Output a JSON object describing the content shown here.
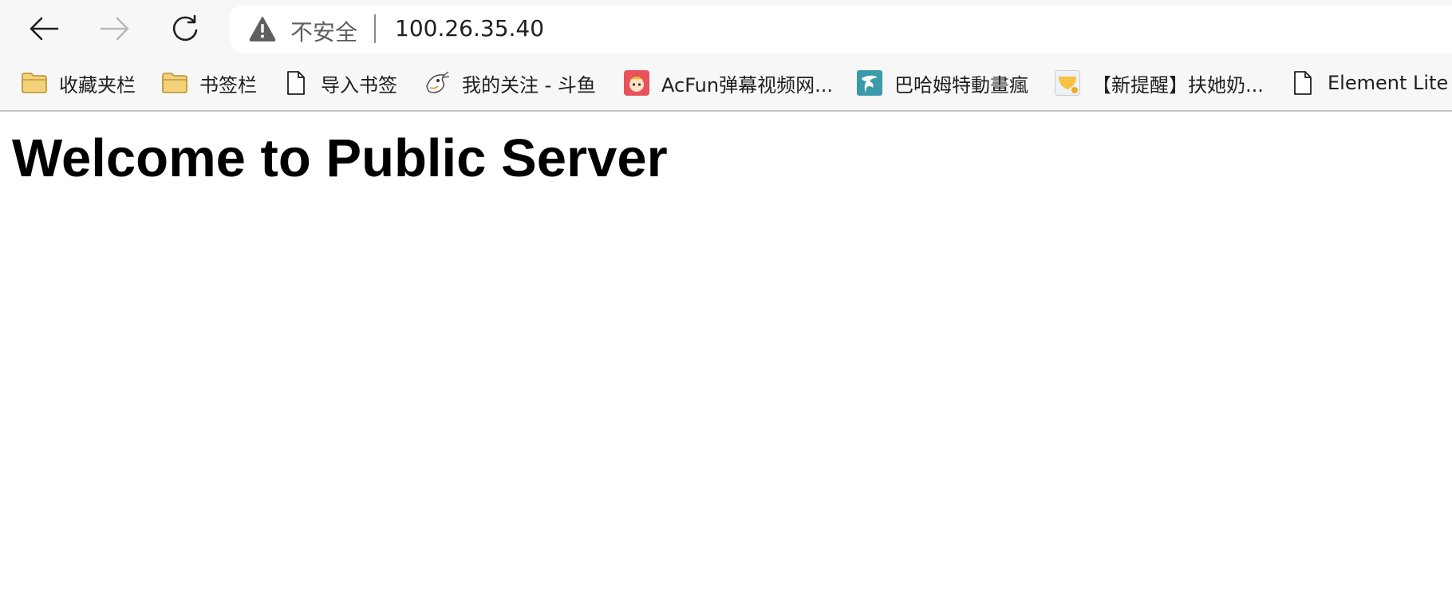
{
  "address_bar": {
    "security_label": "不安全",
    "url": "100.26.35.40"
  },
  "navigation": {
    "back_icon": "arrow-left-icon",
    "forward_icon": "arrow-right-icon",
    "forward_enabled": false,
    "reload_icon": "reload-icon"
  },
  "bookmarks": [
    {
      "label": "收藏夹栏",
      "icon": "folder-icon"
    },
    {
      "label": "书签栏",
      "icon": "folder-icon"
    },
    {
      "label": "导入书签",
      "icon": "page-icon"
    },
    {
      "label": "我的关注 - 斗鱼",
      "icon": "douyu-fish-icon"
    },
    {
      "label": "AcFun弹幕视频网...",
      "icon": "acfun-icon"
    },
    {
      "label": "巴哈姆特動畫瘋",
      "icon": "bahamut-dragon-icon"
    },
    {
      "label": "【新提醒】扶她奶...",
      "icon": "forum-site-icon"
    },
    {
      "label": "Element Lite",
      "icon": "page-icon"
    }
  ],
  "page": {
    "heading": "Welcome to Public Server"
  },
  "colors": {
    "chrome_background": "#f7f7f7",
    "folder_fill": "#f3d27a",
    "folder_stroke": "#b8902f",
    "acfun_red": "#e8525a",
    "bahamut_teal": "#3b9bab",
    "forum_yellow": "#f5c242"
  }
}
